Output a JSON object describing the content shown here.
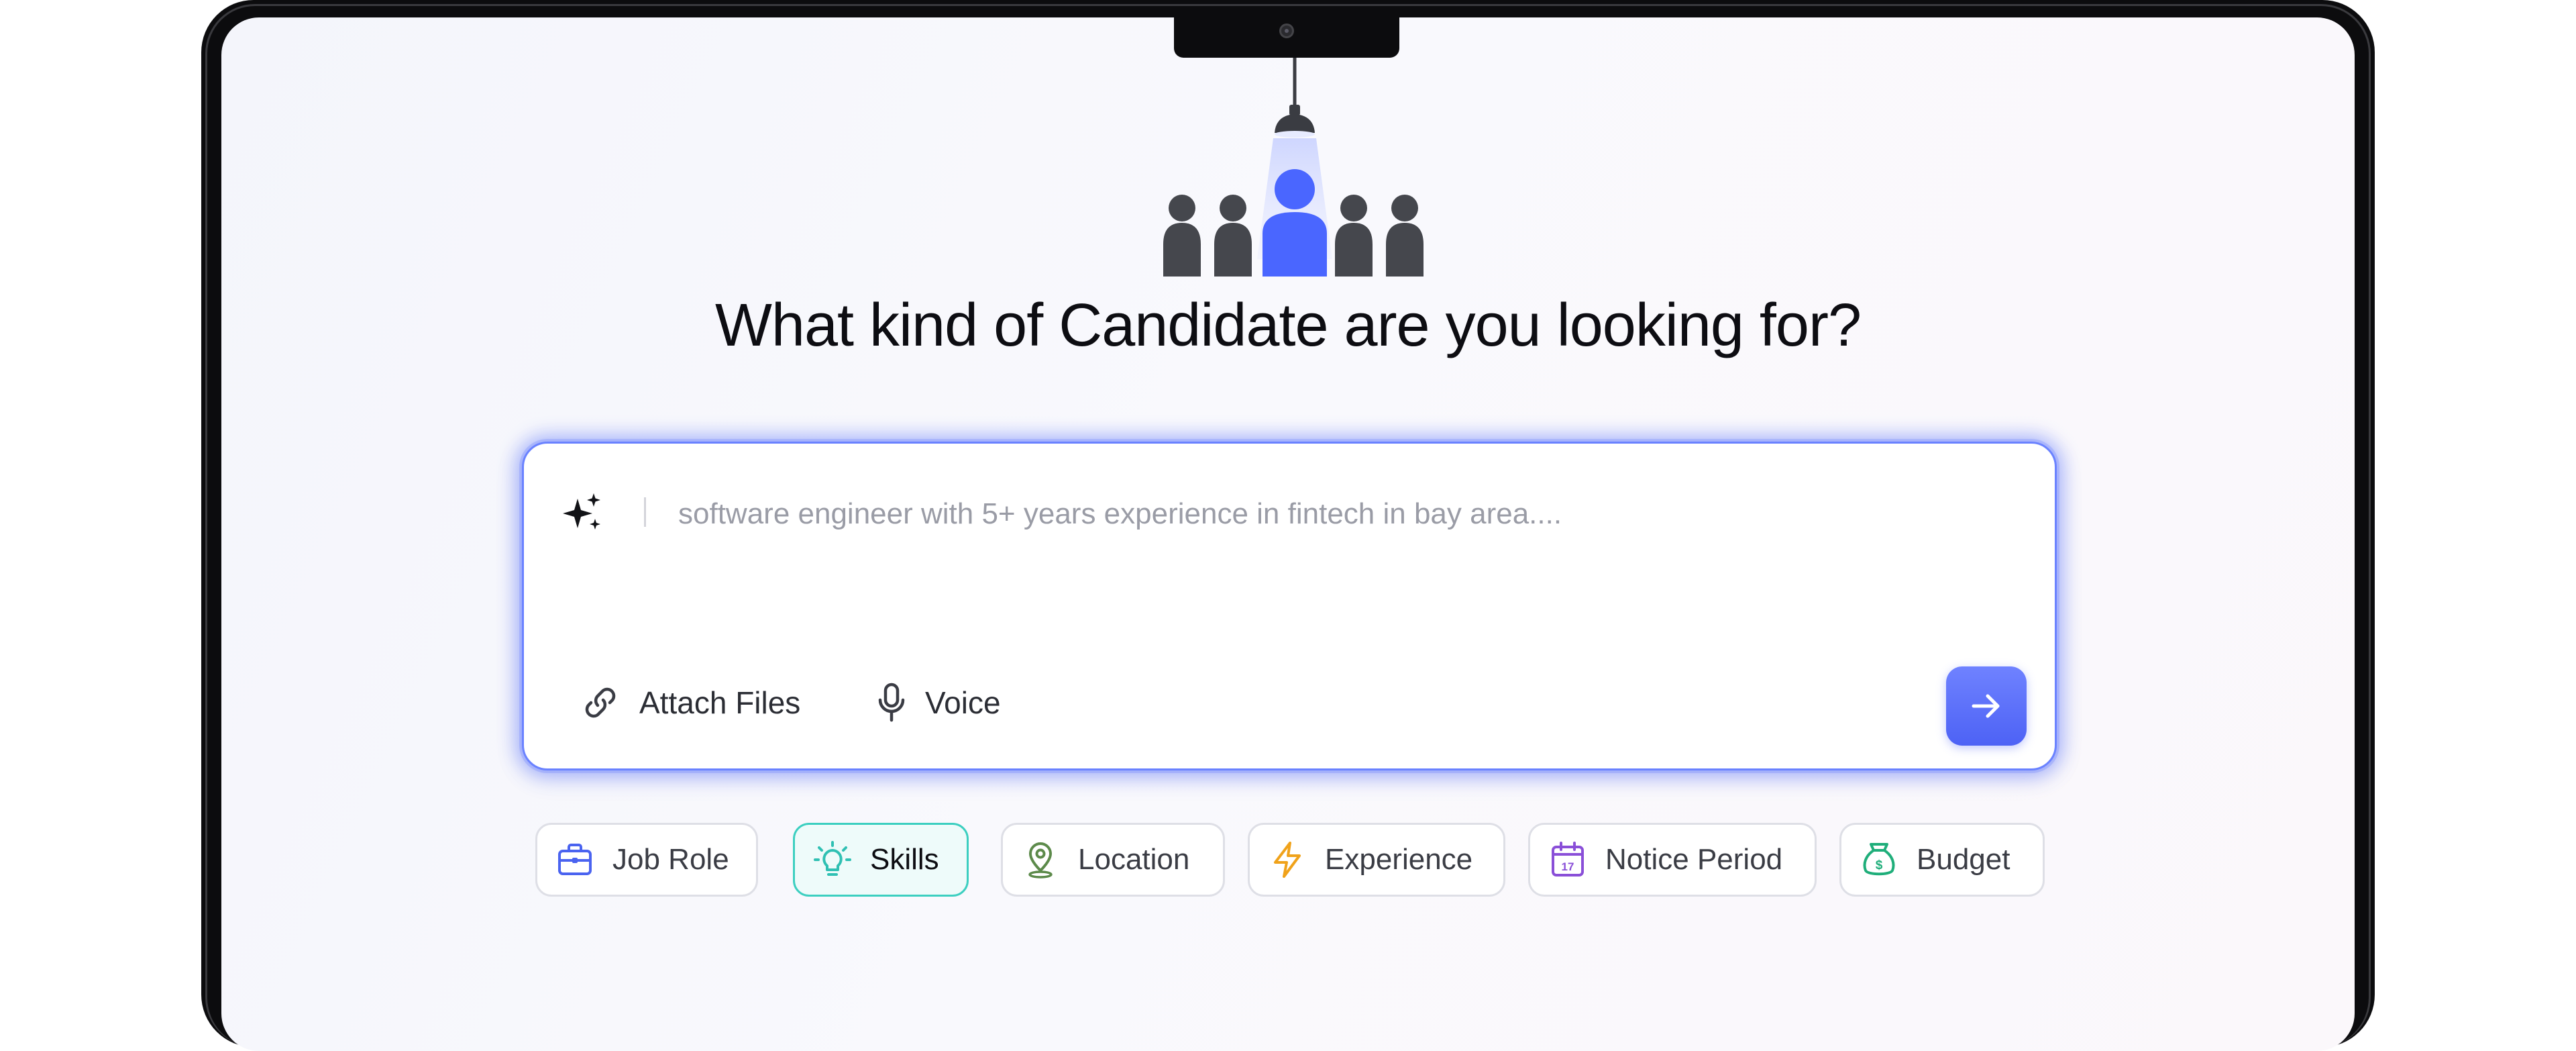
{
  "headline": "What kind of Candidate are you looking for?",
  "search": {
    "placeholder": "software engineer with 5+ years experience in fintech in bay area....",
    "value": ""
  },
  "actions": {
    "attach_label": "Attach Files",
    "voice_label": "Voice"
  },
  "filters": [
    {
      "label": "Job Role",
      "icon": "briefcase-icon",
      "color": "#4a63f0",
      "active": false
    },
    {
      "label": "Skills",
      "icon": "lightbulb-icon",
      "color": "#2fc0b3",
      "active": true
    },
    {
      "label": "Location",
      "icon": "location-pin-icon",
      "color": "#5c8a4a",
      "active": false
    },
    {
      "label": "Experience",
      "icon": "lightning-icon",
      "color": "#f0a21a",
      "active": false
    },
    {
      "label": "Notice Period",
      "icon": "calendar-icon",
      "color": "#8a4fd8",
      "active": false
    },
    {
      "label": "Budget",
      "icon": "money-bag-icon",
      "color": "#1fae7a",
      "active": false
    }
  ],
  "colors": {
    "accent": "#4d62f5",
    "accent_glow": "#6a82ff",
    "active_chip_border": "#3ccfc0",
    "person_dark": "#45474d",
    "person_highlight": "#4a66ff"
  }
}
